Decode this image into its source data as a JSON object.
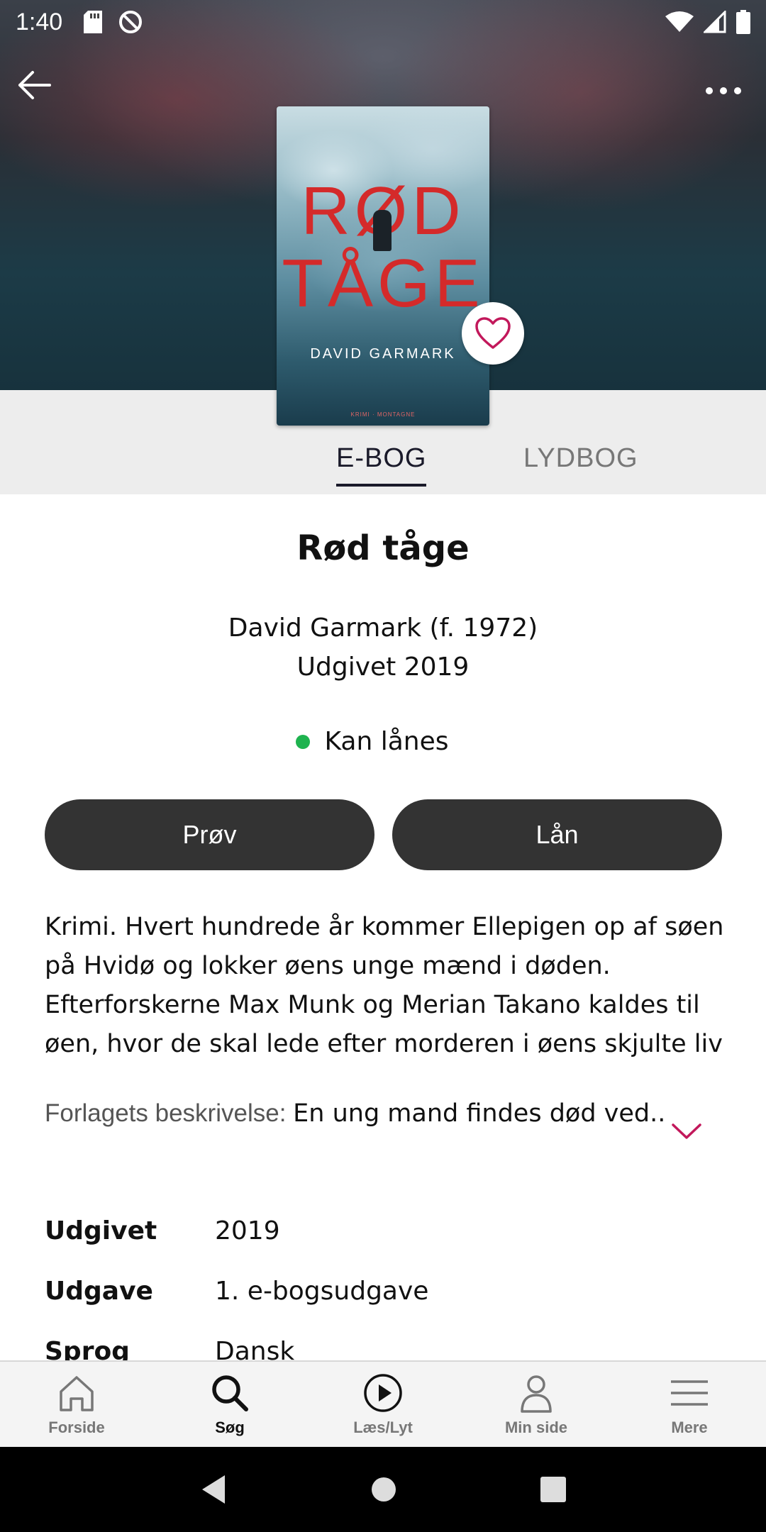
{
  "status_bar": {
    "time": "1:40"
  },
  "book": {
    "cover": {
      "title_line1": "RØD",
      "title_line2": "TÅGE",
      "author": "DAVID GARMARK",
      "publisher": "KRIMI · MONTAGNE"
    },
    "title": "Rød tåge",
    "author": "David Garmark (f. 1972)",
    "published": "Udgivet 2019",
    "availability": "Kan lånes",
    "availability_color": "#1eb34f",
    "description": "Krimi. Hvert hundrede år kommer Ellepigen op af søen på Hvidø og lokker øens unge mænd i døden. Efterforskerne Max Munk og Merian Takano kaldes til øen, hvor de skal lede efter morderen i øens skjulte liv",
    "publisher_description_label": "Forlagets beskrivelse",
    "publisher_description_text": "En ung mand findes død ved.."
  },
  "tabs": [
    {
      "label": "E-BOG",
      "active": true
    },
    {
      "label": "LYDBOG",
      "active": false
    }
  ],
  "actions": {
    "try_label": "Prøv",
    "borrow_label": "Lån"
  },
  "details": [
    {
      "key": "Udgivet",
      "value": "2019"
    },
    {
      "key": "Udgave",
      "value": "1. e-bogsudgave"
    },
    {
      "key": "Sprog",
      "value": "Dansk"
    }
  ],
  "bottom_nav": [
    {
      "label": "Forside",
      "icon": "home-icon",
      "active": false
    },
    {
      "label": "Søg",
      "icon": "search-icon",
      "active": true
    },
    {
      "label": "Læs/Lyt",
      "icon": "play-icon",
      "active": false
    },
    {
      "label": "Min side",
      "icon": "person-icon",
      "active": false
    },
    {
      "label": "Mere",
      "icon": "menu-icon",
      "active": false
    }
  ],
  "colors": {
    "accent": "#c2185b",
    "button": "#333333"
  }
}
